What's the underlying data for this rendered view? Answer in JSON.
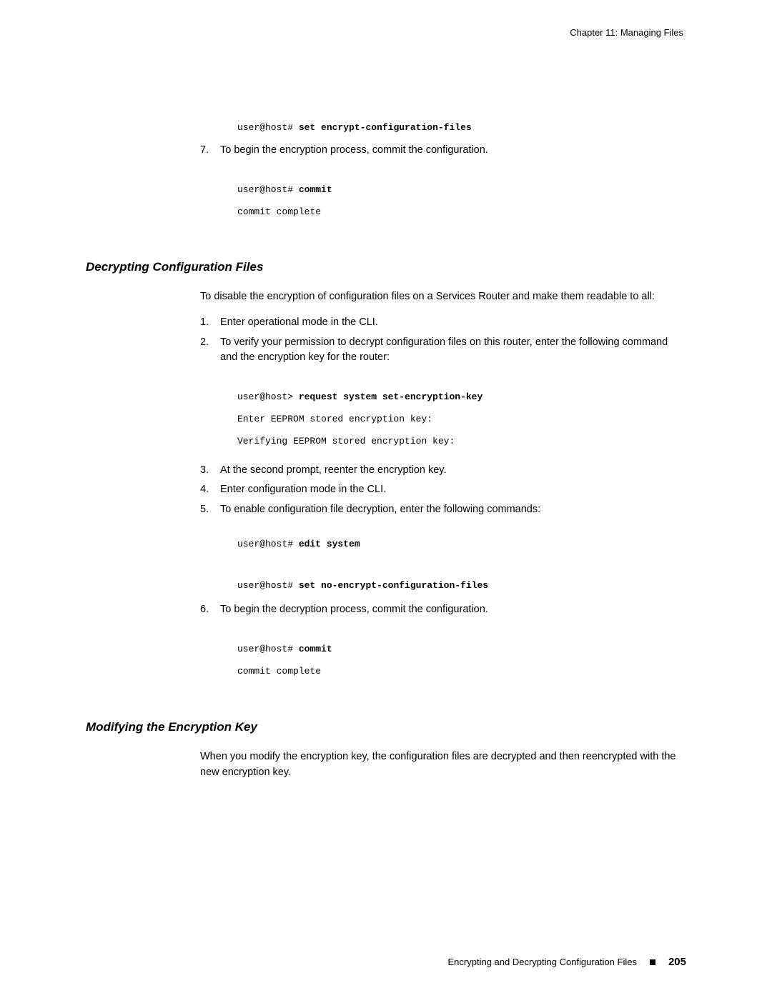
{
  "header": {
    "chapter": "Chapter 11: Managing Files"
  },
  "intro": {
    "code1_prompt": "user@host# ",
    "code1_cmd": "set encrypt-configuration-files",
    "step7_num": "7.",
    "step7_text": "To begin the encryption process, commit the configuration.",
    "code2_line1_prompt": "user@host# ",
    "code2_line1_cmd": "commit",
    "code2_line2": "commit complete"
  },
  "sectionA": {
    "title": "Decrypting Configuration Files",
    "intro": "To disable the encryption of configuration files on a Services Router and make them readable to all:",
    "steps": {
      "n1": "1.",
      "t1": "Enter operational mode in the CLI.",
      "n2": "2.",
      "t2": "To verify your permission to decrypt configuration files on this router, enter the following command and the encryption key for the router:",
      "code2_prompt": "user@host> ",
      "code2_cmd": "request system set-encryption-key",
      "code2_l2": "Enter EEPROM stored encryption key:",
      "code2_l3": "Verifying EEPROM stored encryption key:",
      "n3": "3.",
      "t3": "At the second prompt, reenter the encryption key.",
      "n4": "4.",
      "t4": "Enter configuration mode in the CLI.",
      "n5": "5.",
      "t5": "To enable configuration file decryption, enter the following commands:",
      "code5_l1_prompt": "user@host# ",
      "code5_l1_cmd": "edit system",
      "code5_l2_prompt": "user@host# ",
      "code5_l2_cmd": "set no-encrypt-configuration-files",
      "n6": "6.",
      "t6": "To begin the decryption process, commit the configuration.",
      "code6_l1_prompt": "user@host# ",
      "code6_l1_cmd": "commit",
      "code6_l2": "commit complete"
    }
  },
  "sectionB": {
    "title": "Modifying the Encryption Key",
    "para": "When you modify the encryption key, the configuration files are decrypted and then reencrypted with the new encryption key."
  },
  "footer": {
    "label": "Encrypting and Decrypting Configuration Files",
    "page": "205"
  }
}
